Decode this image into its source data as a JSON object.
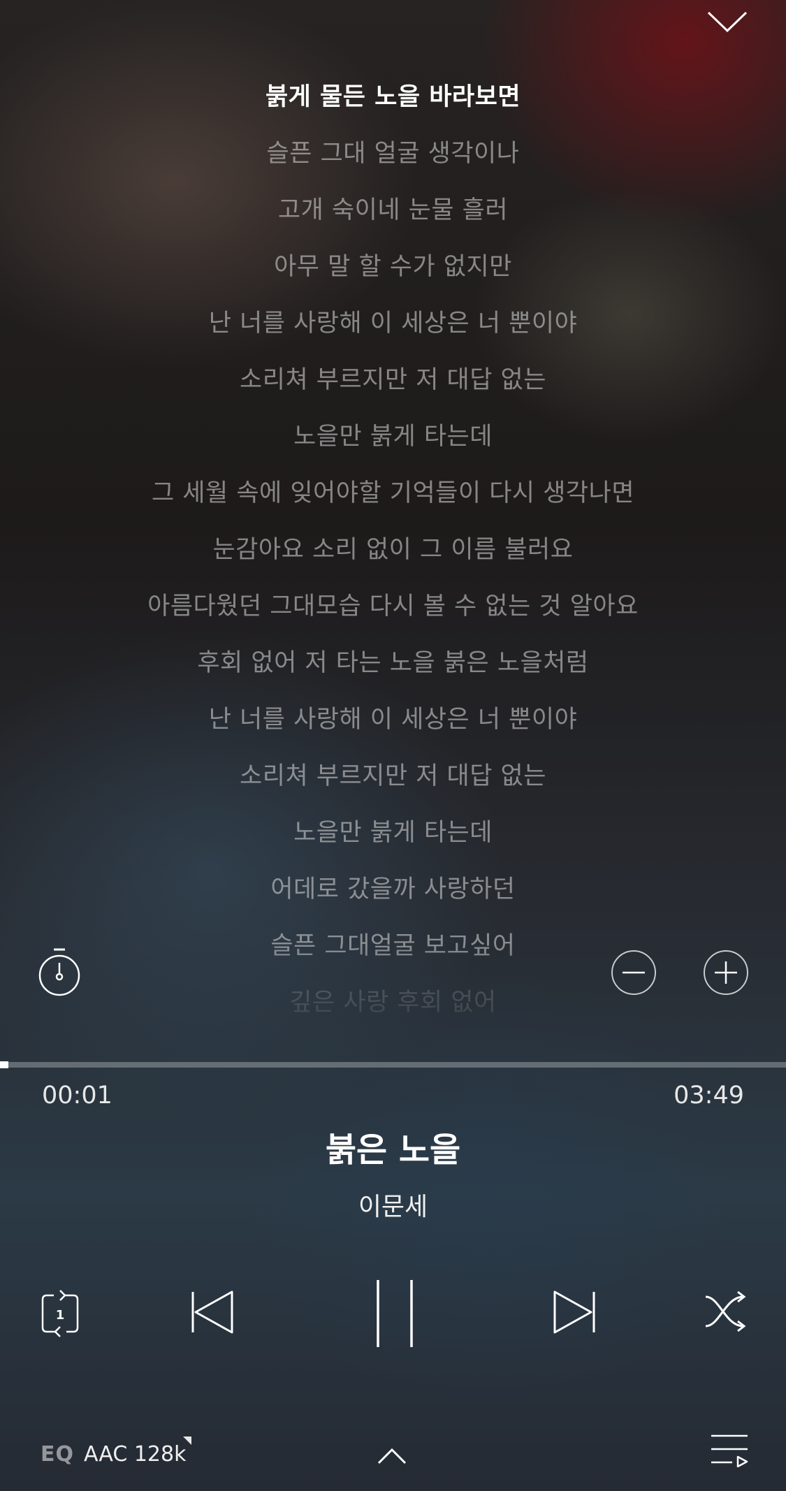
{
  "lyrics": {
    "current": "붉게 물든 노을 바라보면",
    "lines": [
      "슬픈 그대 얼굴 생각이나",
      "고개 숙이네 눈물 흘러",
      "아무 말 할 수가 없지만",
      "난 너를 사랑해 이 세상은 너 뿐이야",
      "소리쳐 부르지만 저 대답 없는",
      "노을만 붉게 타는데",
      "그 세월 속에 잊어야할 기억들이 다시 생각나면",
      "눈감아요 소리 없이 그 이름 불러요",
      "아름다웠던 그대모습 다시 볼 수 없는 것 알아요",
      "후회 없어 저 타는 노을 붉은 노을처럼",
      "난 너를 사랑해 이 세상은 너 뿐이야",
      "소리쳐 부르지만 저 대답 없는",
      "노을만 붉게 타는데",
      "어데로 갔을까 사랑하던",
      "슬픈 그대얼굴 보고싶어",
      "깊은 사랑 후회 없어"
    ]
  },
  "player": {
    "progress_fraction": 0.004,
    "elapsed": "00:01",
    "total": "03:49",
    "title": "붉은 노을",
    "artist": "이문세",
    "repeat_badge": "1"
  },
  "footer": {
    "eq_label": "EQ",
    "quality": "AAC 128k"
  },
  "icons": {
    "collapse": "chevron-down-icon",
    "timer": "stopwatch-icon",
    "font_minus": "minus-circle-icon",
    "font_plus": "plus-circle-icon",
    "repeat": "repeat-one-icon",
    "prev": "skip-previous-icon",
    "pause": "pause-icon",
    "next": "skip-next-icon",
    "shuffle": "shuffle-icon",
    "expand": "chevron-up-icon",
    "playlist": "playlist-icon"
  }
}
